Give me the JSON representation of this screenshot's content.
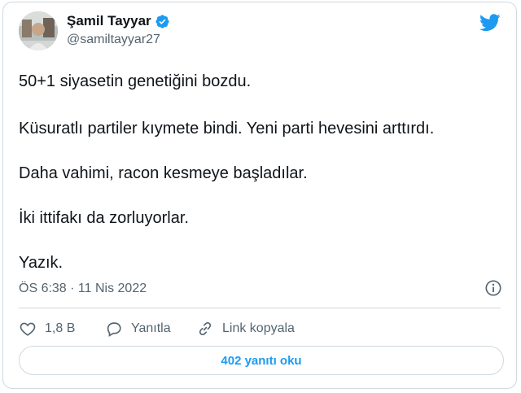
{
  "author": {
    "display_name": "Şamil Tayyar",
    "handle": "@samiltayyar27"
  },
  "tweet": {
    "lines": [
      "50+1 siyasetin genetiğini bozdu.",
      "Küsuratlı partiler kıymete bindi. Yeni parti hevesini arttırdı.",
      "Daha vahimi, racon kesmeye başladılar.",
      "İki ittifakı da zorluyorlar.",
      "Yazık."
    ],
    "timestamp": "ÖS 6:38 · 11 Nis 2022"
  },
  "actions": {
    "like_count": "1,8 B",
    "reply_label": "Yanıtla",
    "copy_link_label": "Link kopyala"
  },
  "read_replies_label": "402 yanıtı oku",
  "icons": {
    "bird": "twitter-bird-icon",
    "verified": "verified-badge-icon",
    "info": "info-icon",
    "like": "heart-icon",
    "reply": "speech-bubble-icon",
    "link": "link-icon"
  },
  "colors": {
    "accent": "#1d9bf0",
    "text": "#0f1419",
    "secondary": "#536471",
    "border": "#cfd9de"
  }
}
